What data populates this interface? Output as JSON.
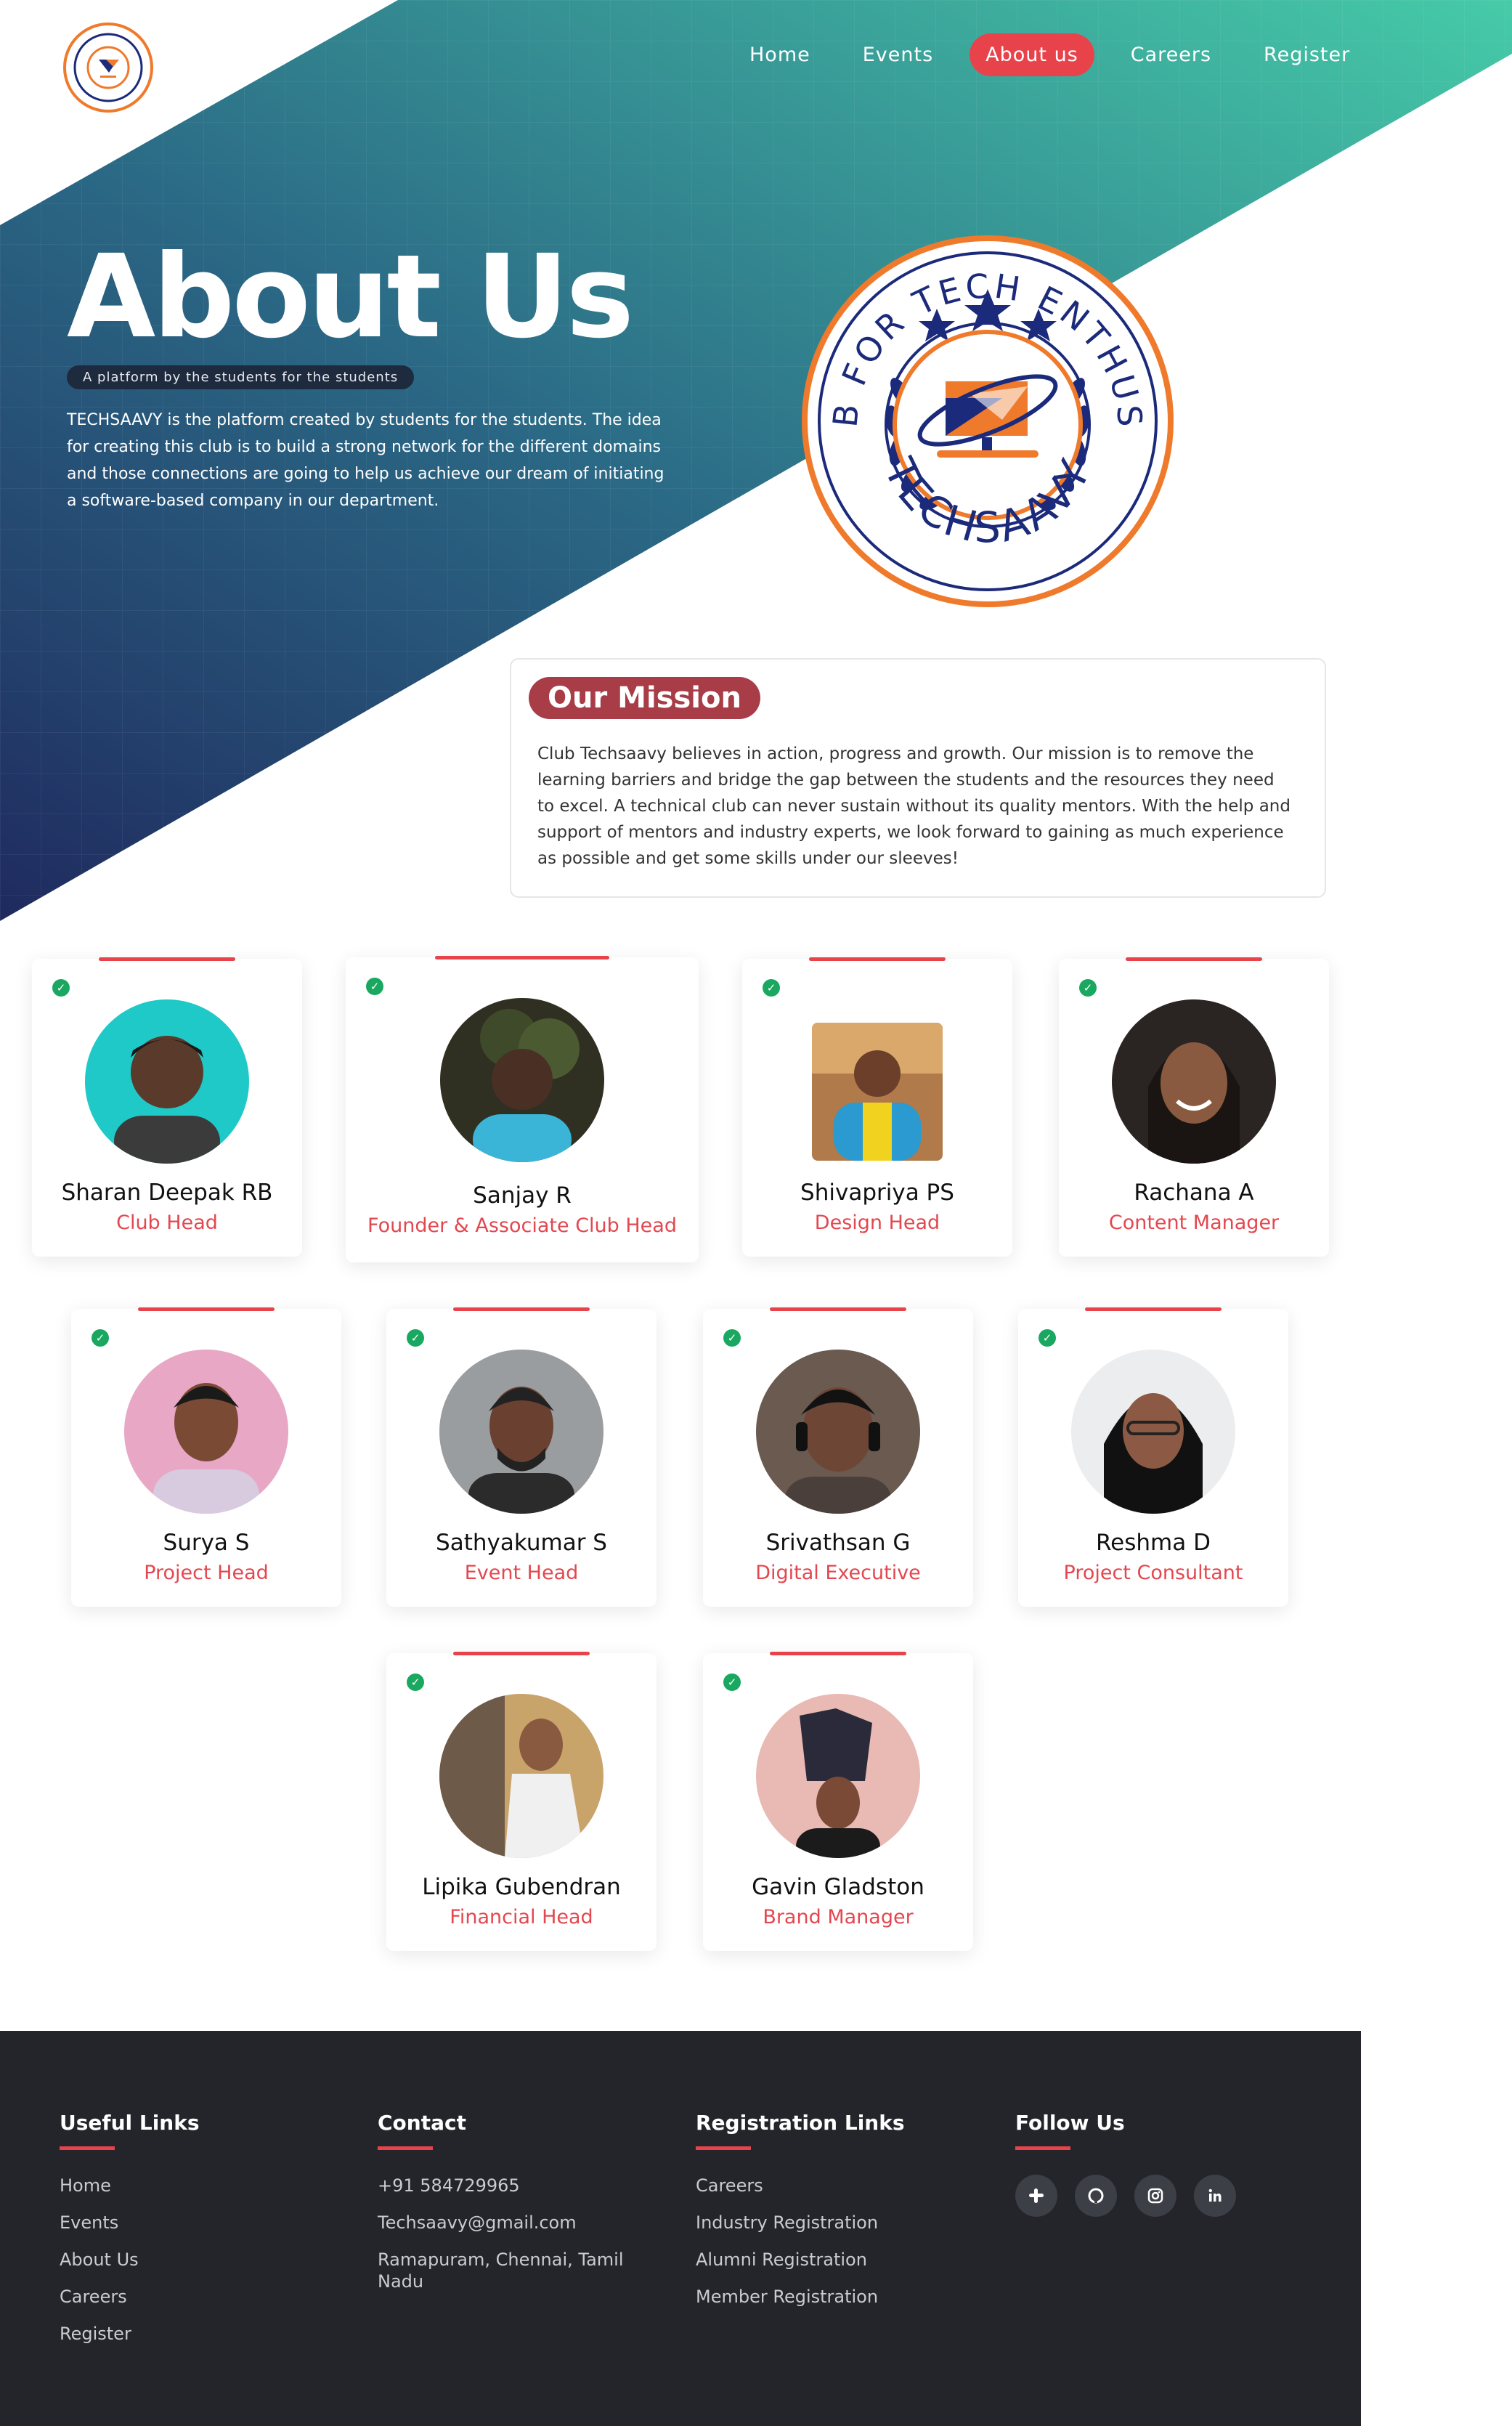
{
  "nav": {
    "items": [
      "Home",
      "Events",
      "About us",
      "Careers",
      "Register"
    ],
    "active": "About us"
  },
  "hero": {
    "title": "About Us",
    "tagline": "A platform by the students for the students",
    "description": "TECHSAAVY is the platform created by students for the students. The idea for creating this club is to build a strong network for the different domains and those connections are going to help us achieve our dream of initiating a software-based company in our department."
  },
  "logo": {
    "top_text": "A CLUB FOR TECH ENTHUSIASTS",
    "bottom_text": "TECHSAAVY"
  },
  "mission": {
    "title": "Our Mission",
    "text": "Club Techsaavy believes in action, progress and growth. Our mission is to remove the learning barriers and bridge the gap between the students and the resources they need to excel. A technical club can never sustain without its quality mentors. With the help and support of mentors and industry experts, we look forward to gaining as much experience as possible and get some skills under our sleeves!"
  },
  "team": [
    {
      "name": "Sharan Deepak RB",
      "role": "Club Head"
    },
    {
      "name": "Sanjay R",
      "role": "Founder & Associate Club Head"
    },
    {
      "name": "Shivapriya PS",
      "role": "Design Head"
    },
    {
      "name": "Rachana A",
      "role": "Content Manager"
    },
    {
      "name": "Surya S",
      "role": "Project Head"
    },
    {
      "name": "Sathyakumar S",
      "role": "Event Head"
    },
    {
      "name": "Srivathsan G",
      "role": "Digital Executive"
    },
    {
      "name": "Reshma D",
      "role": "Project Consultant"
    },
    {
      "name": "Lipika Gubendran",
      "role": "Financial Head"
    },
    {
      "name": "Gavin Gladston",
      "role": "Brand Manager"
    }
  ],
  "footer": {
    "useful": {
      "title": "Useful Links",
      "links": [
        "Home",
        "Events",
        "About Us",
        "Careers",
        "Register"
      ]
    },
    "contact": {
      "title": "Contact",
      "phone": "+91 584729965",
      "email": "Techsaavy@gmail.com",
      "address": "Ramapuram, Chennai, Tamil Nadu"
    },
    "registration": {
      "title": "Registration Links",
      "links": [
        "Careers",
        "Industry Registration",
        "Alumni Registration",
        "Member Registration"
      ]
    },
    "follow": {
      "title": "Follow Us",
      "icons": [
        "slack-icon",
        "github-icon",
        "instagram-icon",
        "linkedin-icon"
      ]
    }
  },
  "colors": {
    "accent": "#e8434b",
    "navy": "#1b2a5e",
    "teal": "#45c8a8",
    "footer": "#24252b",
    "success": "#1aa861"
  }
}
